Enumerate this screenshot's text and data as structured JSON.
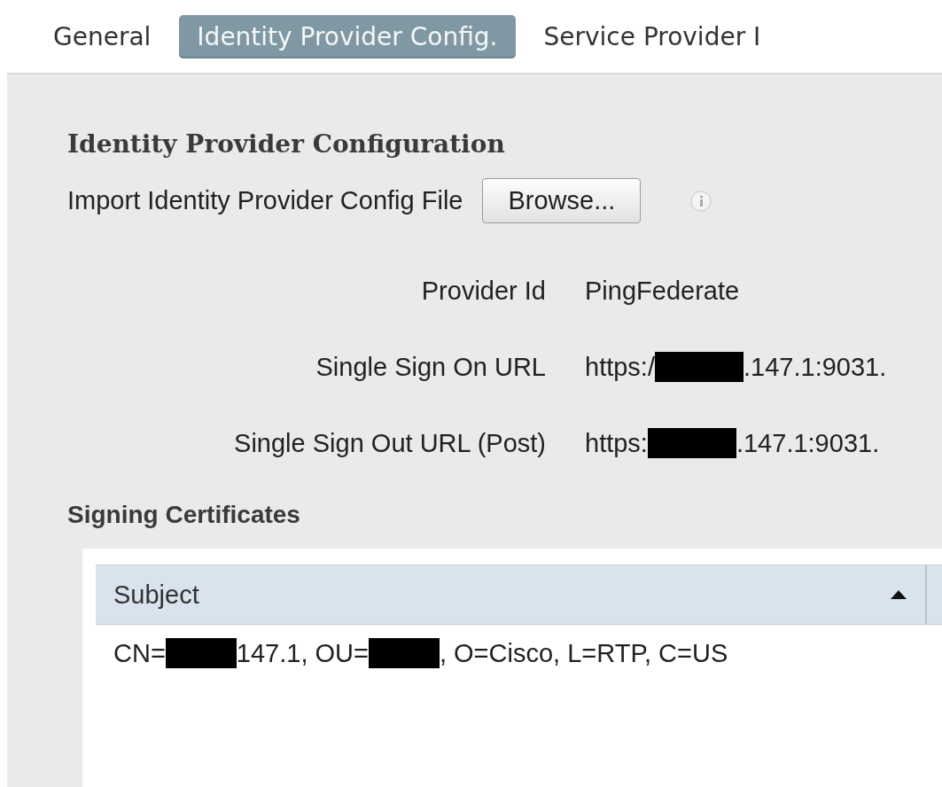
{
  "tabs": [
    {
      "label": "General",
      "selected": false
    },
    {
      "label": "Identity Provider Config.",
      "selected": true
    },
    {
      "label": "Service Provider I",
      "selected": false
    }
  ],
  "section_title": "Identity Provider Configuration",
  "import": {
    "label": "Import Identity Provider Config File",
    "button": "Browse..."
  },
  "fields": [
    {
      "label": "Provider Id",
      "value_parts": [
        {
          "kind": "text",
          "text": "PingFederate"
        }
      ]
    },
    {
      "label": "Single Sign On URL",
      "value_parts": [
        {
          "kind": "text",
          "text": "https:/"
        },
        {
          "kind": "redaction"
        },
        {
          "kind": "text",
          "text": ".147.1:9031."
        }
      ]
    },
    {
      "label": "Single Sign Out URL (Post)",
      "value_parts": [
        {
          "kind": "text",
          "text": "https:"
        },
        {
          "kind": "redaction"
        },
        {
          "kind": "text",
          "text": ".147.1:9031."
        }
      ]
    }
  ],
  "certificates": {
    "title": "Signing Certificates",
    "columns": [
      {
        "label": "Subject",
        "sort_ascending": true
      }
    ],
    "rows": [
      {
        "subject_parts": [
          {
            "kind": "text",
            "text": "CN="
          },
          {
            "kind": "redaction"
          },
          {
            "kind": "text",
            "text": "147.1, OU="
          },
          {
            "kind": "redaction"
          },
          {
            "kind": "text",
            "text": ", O=Cisco, L=RTP, C=US"
          }
        ]
      }
    ]
  }
}
